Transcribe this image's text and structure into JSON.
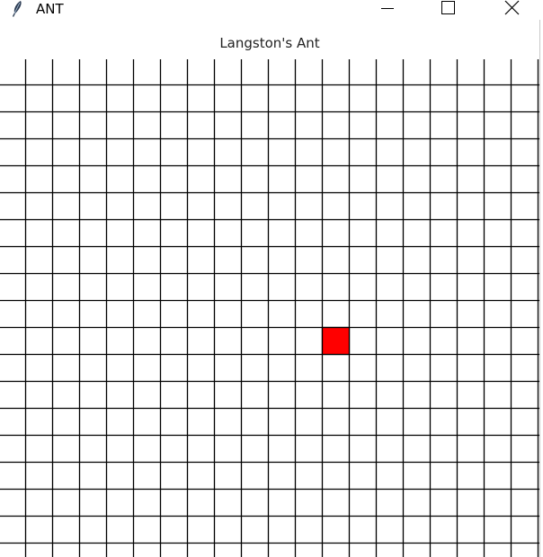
{
  "window": {
    "title": "ANT",
    "icon": "feather-icon",
    "controls": [
      "minimize-icon",
      "maximize-icon",
      "close-icon"
    ]
  },
  "game": {
    "heading": "Langston's Ant",
    "colors": {
      "grid_line": "#000000",
      "ant_fill": "#ff0000",
      "background": "#ffffff"
    },
    "grid": {
      "visible_columns": 20,
      "visible_rows": 18
    },
    "ant": {
      "column": 11,
      "row": 10
    }
  }
}
